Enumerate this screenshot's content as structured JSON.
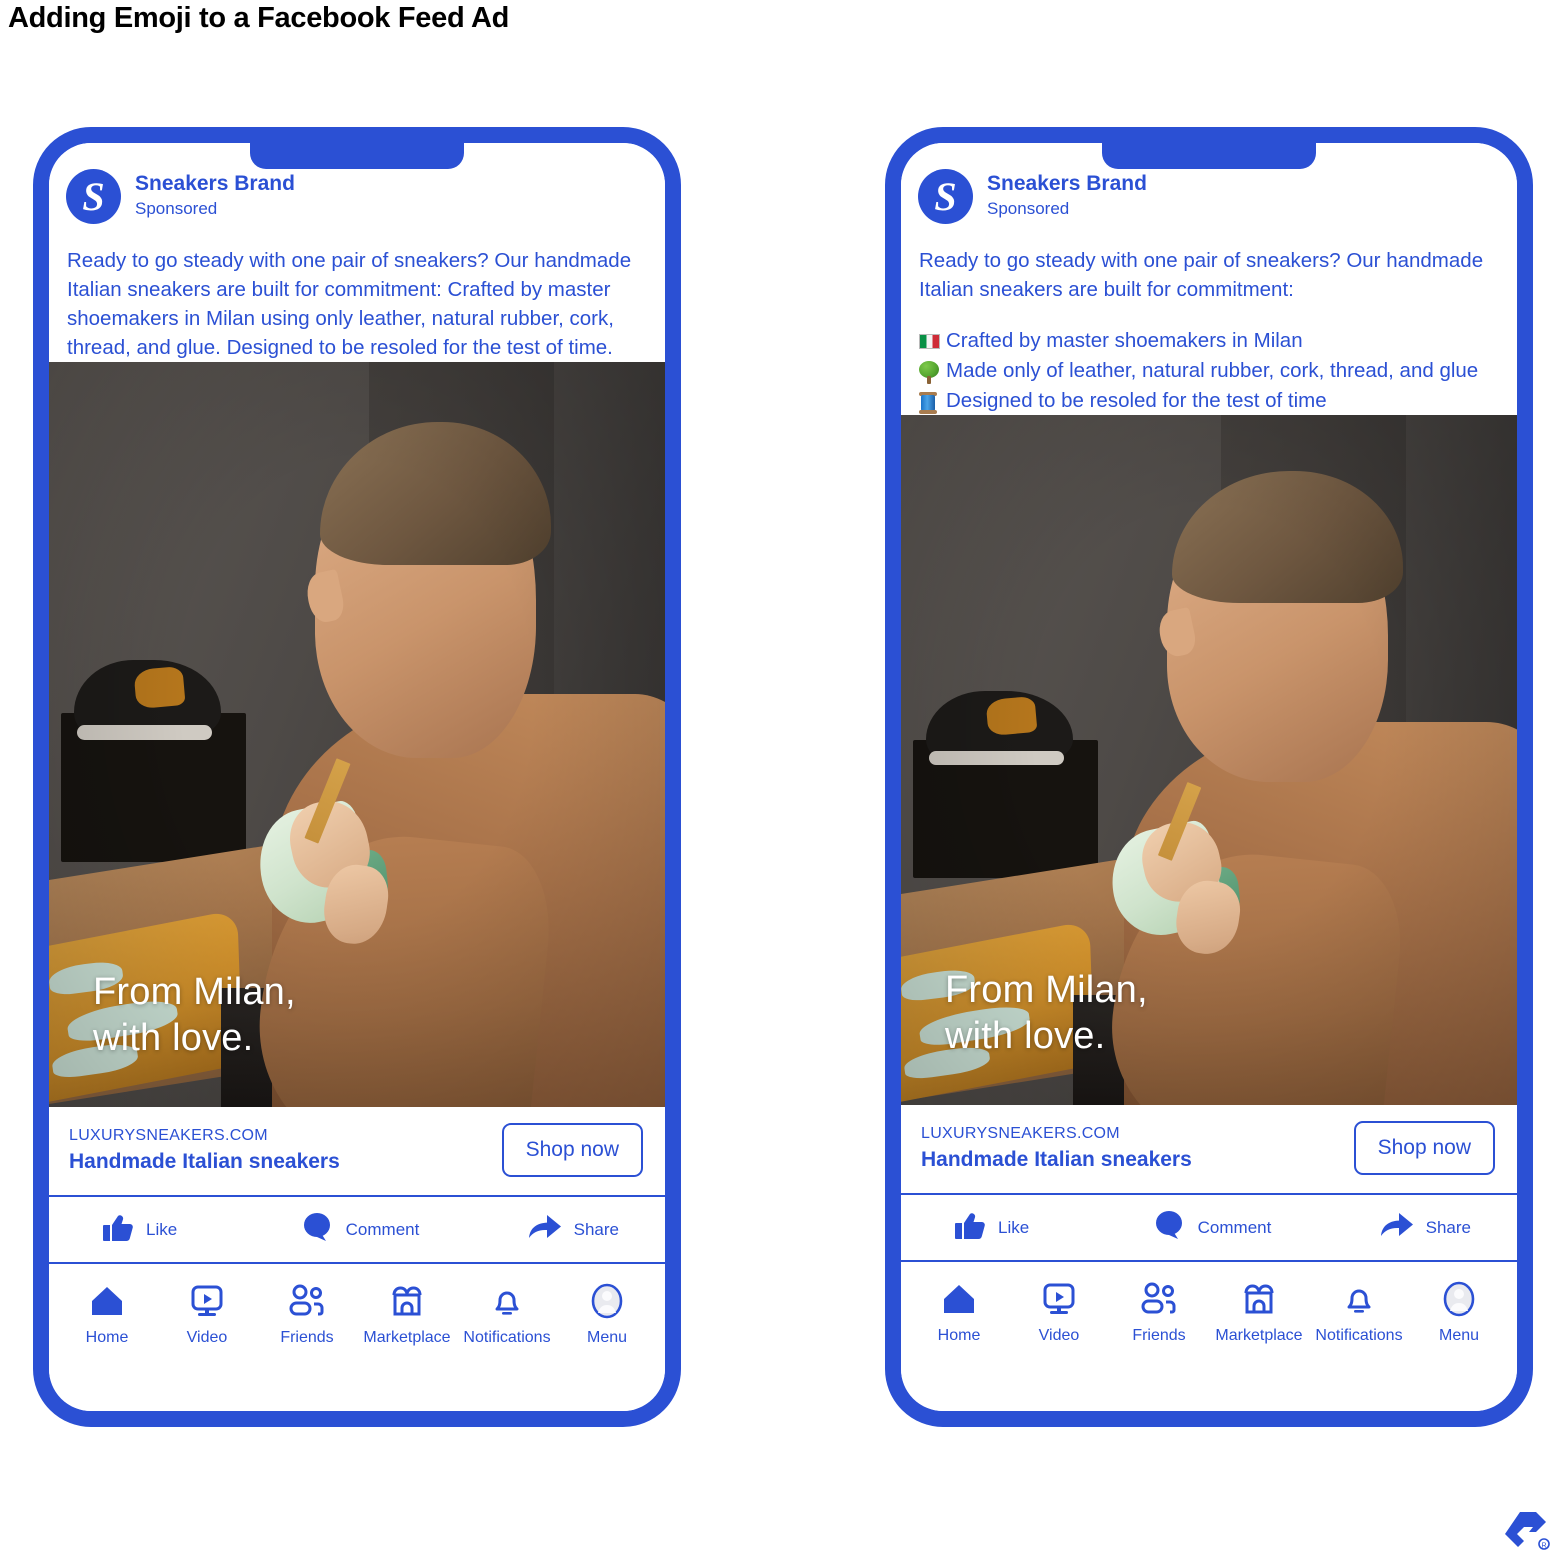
{
  "page": {
    "title": "Adding Emoji to a Facebook Feed Ad"
  },
  "colors": {
    "brand_blue": "#2B50D4",
    "frame_blue": "#2B50D4",
    "overlay_text": "#FFFFFF"
  },
  "ad": {
    "avatar_letter": "S",
    "brand_name": "Sneakers Brand",
    "sponsored_label": "Sponsored",
    "image_overlay_line1": "From Milan,",
    "image_overlay_line2": "with love.",
    "link_domain": "LUXURYSNEAKERS.COM",
    "link_headline": "Handmade Italian sneakers",
    "cta_button": "Shop now"
  },
  "variant_left": {
    "body_text": "Ready to go steady with one pair of sneakers? Our handmade Italian sneakers are built for commitment: Crafted by master shoemakers in Milan using only leather, natural rubber, cork, thread, and glue. Designed to be resoled for the test of time."
  },
  "variant_right": {
    "body_text": "Ready to go steady with one pair of sneakers? Our handmade Italian sneakers are built for commitment:",
    "bullets": [
      {
        "emoji_name": "italian-flag-emoji",
        "text": "Crafted by master shoemakers in Milan"
      },
      {
        "emoji_name": "tree-emoji",
        "text": "Made only of leather, natural rubber, cork, thread, and glue"
      },
      {
        "emoji_name": "thread-spool-emoji",
        "text": "Designed to be resoled for the test of time"
      }
    ]
  },
  "reactions": [
    {
      "icon": "thumbs-up-icon",
      "label": "Like"
    },
    {
      "icon": "comment-bubble-icon",
      "label": "Comment"
    },
    {
      "icon": "share-arrow-icon",
      "label": "Share"
    }
  ],
  "bottom_nav": [
    {
      "icon": "home-icon",
      "label": "Home"
    },
    {
      "icon": "video-icon",
      "label": "Video"
    },
    {
      "icon": "friends-icon",
      "label": "Friends"
    },
    {
      "icon": "marketplace-icon",
      "label": "Marketplace"
    },
    {
      "icon": "notifications-bell-icon",
      "label": "Notifications"
    },
    {
      "icon": "menu-avatar-icon",
      "label": "Menu"
    }
  ]
}
